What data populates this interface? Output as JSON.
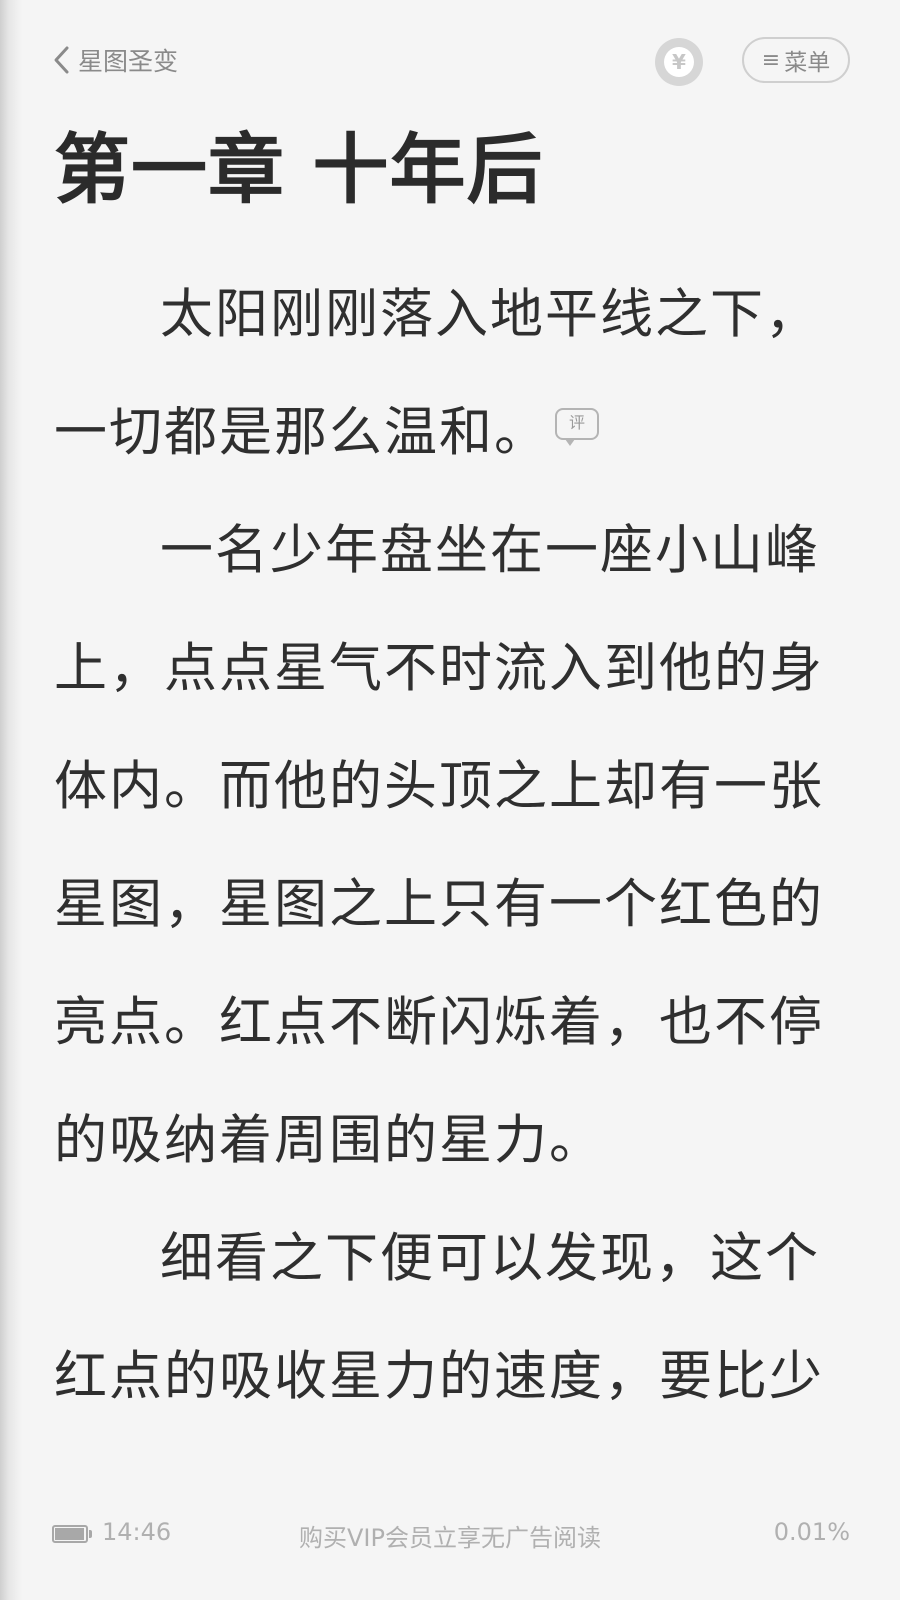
{
  "header": {
    "back_label": "星图圣变",
    "coin_symbol": "¥",
    "menu_label": "菜单",
    "menu_icon": "≡"
  },
  "chapter": {
    "title": "第一章 十年后",
    "paragraphs": [
      "太阳刚刚落入地平线之下，一切都是那么温和。",
      "一名少年盘坐在一座小山峰上，点点星气不时流入到他的身体内。而他的头顶之上却有一张星图，星图之上只有一个红色的亮点。红点不断闪烁着，也不停的吸纳着周围的星力。",
      "细看之下便可以发现，这个红点的吸收星力的速度，要比少"
    ],
    "comment_badge": "评"
  },
  "footer": {
    "battery_level": 0.95,
    "time": "14:46",
    "vip_text": "购买VIP会员立享无广告阅读",
    "progress": "0.01%"
  },
  "colors": {
    "background": "#f5f5f5",
    "text": "#2f2f2f",
    "muted": "#8a8a8a"
  }
}
